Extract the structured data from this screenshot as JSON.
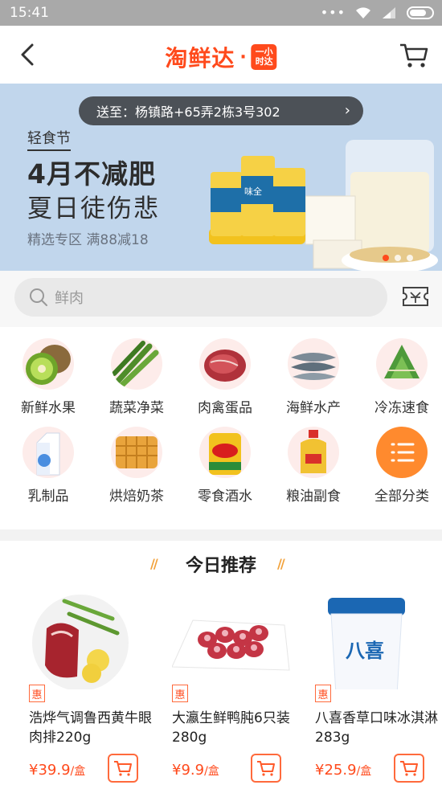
{
  "status_bar": {
    "time": "15:41"
  },
  "header": {
    "logo_text": "淘鲜达",
    "logo_dot": "·",
    "logo_badge": "一小时达"
  },
  "banner": {
    "address": "送至：杨镇路+65弄2栋3号302",
    "tag": "轻食节",
    "title": "4月不减肥",
    "subtitle": "夏日徒伤悲",
    "note": "精选专区 满88减18",
    "product_brand": "味全"
  },
  "search": {
    "placeholder": "鲜肉"
  },
  "categories": [
    {
      "label": "新鲜水果",
      "icon": "kiwi-icon"
    },
    {
      "label": "蔬菜净菜",
      "icon": "asparagus-icon"
    },
    {
      "label": "肉禽蛋品",
      "icon": "steak-icon"
    },
    {
      "label": "海鲜水产",
      "icon": "fish-icon"
    },
    {
      "label": "冷冻速食",
      "icon": "zongzi-icon"
    },
    {
      "label": "乳制品",
      "icon": "milk-carton-icon"
    },
    {
      "label": "烘焙奶茶",
      "icon": "waffle-icon"
    },
    {
      "label": "零食酒水",
      "icon": "chips-can-icon"
    },
    {
      "label": "粮油副食",
      "icon": "oil-bottle-icon"
    },
    {
      "label": "全部分类",
      "icon": "list-icon"
    }
  ],
  "recommend": {
    "title": "今日推荐",
    "badge": "惠",
    "products": [
      {
        "name": "浩烨气调鲁西黄牛眼肉排220g",
        "price": "¥39.9",
        "unit": "/盒"
      },
      {
        "name": "大瀛生鲜鸭肫6只装280g",
        "price": "¥9.9",
        "unit": "/盒"
      },
      {
        "name": "八喜香草口味冰淇淋283g",
        "price": "¥25.9",
        "unit": "/盒",
        "brand": "八喜"
      }
    ]
  },
  "colors": {
    "brand": "#ff4a1c",
    "banner_bg": "#c1d6ec",
    "accent": "#f2a23b"
  }
}
